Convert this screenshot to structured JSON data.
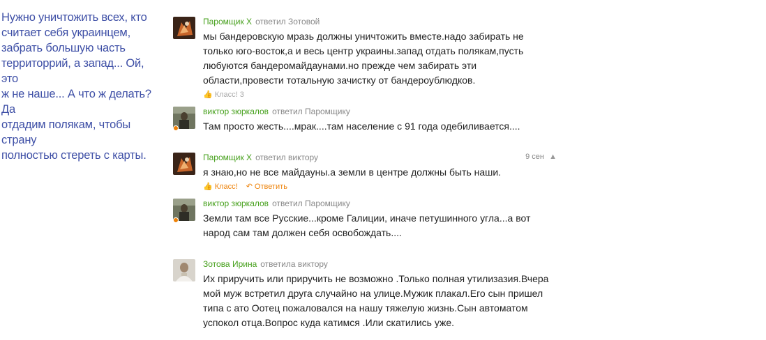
{
  "caption": "Нужно уничтожить всех, кто\nсчитает себя украинцем,\nзабрать большую часть\nтерриторрий, а запад... Ой, это\nж не наше... А что ж делать? Да\nотдадим полякам, чтобы страну\nполностью стереть с карты.",
  "comments": [
    {
      "author": "Паромщик Х",
      "action": "ответил Зотовой",
      "text": "мы бандеровскую мразь должны уничтожить вместе.надо забирать не\nтолько юго-восток,а и весь центр украины.запад отдать полякам,пусть\nлюбуются бандеромайдаунами.но прежде чем забирать эти\nобласти,провести тотальную зачистку от бандероублюдков.",
      "klass_label": "Класс! 3"
    },
    {
      "author": "виктор зюркалов",
      "action": "ответил Паромщику",
      "text": "Там просто жесть....мрак....там население с 91 года одебиливается...."
    },
    {
      "author": "Паромщик Х",
      "action": "ответил виктору",
      "time": "9 сен",
      "text": "я знаю,но не все майдауны.а земли в центре должны быть наши.",
      "klass_label": "Класс!",
      "reply_label": "Ответить"
    },
    {
      "author": "виктор зюркалов",
      "action": "ответил Паромщику",
      "text": "Земли там все Русские...кроме Галиции, иначе петушинного угла...а вот\nнарод сам там должен себя освобождать...."
    },
    {
      "author": "Зотова Ирина",
      "action": "ответила виктору",
      "text": "Их приручить или приручить не возможно .Только полная утилизазия.Вчера\nмой муж встретил друга случайно на улице.Мужик плакал.Его сын пришел\nтипа с ато Оотец пожаловался на нашу тяжелую жизнь.Сын автоматом\nуспокол отца.Вопрос куда катимся .Или скатились уже."
    }
  ],
  "colors": {
    "caption": "#3e4fa6",
    "author": "#46a01c",
    "accent": "#ee8208",
    "meta": "#888888",
    "text": "#222222"
  },
  "icons": {
    "like": "thumbs-up-icon",
    "reply": "reply-arrow-icon",
    "report": "warning-icon"
  }
}
